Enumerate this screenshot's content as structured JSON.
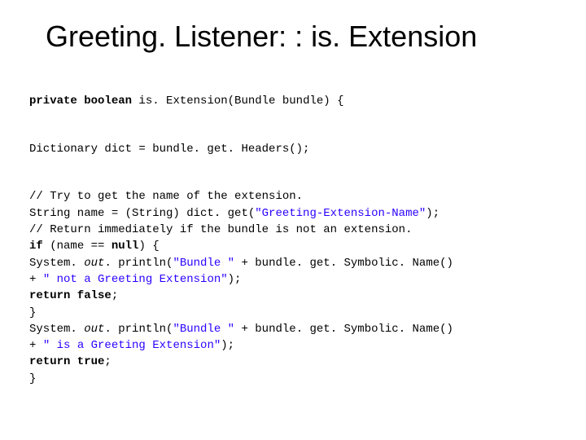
{
  "title": "Greeting. Listener: : is. Extension",
  "code": {
    "l1_kw1": "private boolean",
    "l1_rest": " is. Extension(Bundle bundle) {",
    "l2": "Dictionary dict = bundle. get. Headers();",
    "l3": "// Try to get the name of the extension.",
    "l4a": "String name = (String) dict. get(",
    "l4b": "\"Greeting-Extension-Name\"",
    "l4c": ");",
    "l5": "// Return immediately if the bundle is not an extension.",
    "l6_kw": "if",
    "l6_rest": " (name == ",
    "l6_kw2": "null",
    "l6_rest2": ") {",
    "l7a": "System. ",
    "l7b": "out",
    "l7c": ". println(",
    "l7d": "\"Bundle \"",
    "l7e": " + bundle. get. Symbolic. Name()",
    "l8a": "+ ",
    "l8b": "\" not a Greeting Extension\"",
    "l8c": ");",
    "l9_kw": "return false",
    "l9_rest": ";",
    "l10": "}",
    "l11a": "System. ",
    "l11b": "out",
    "l11c": ". println(",
    "l11d": "\"Bundle \"",
    "l11e": " + bundle. get. Symbolic. Name()",
    "l12a": "+ ",
    "l12b": "\" is a Greeting Extension\"",
    "l12c": ");",
    "l13_kw": "return true",
    "l13_rest": ";",
    "l14": "}"
  }
}
